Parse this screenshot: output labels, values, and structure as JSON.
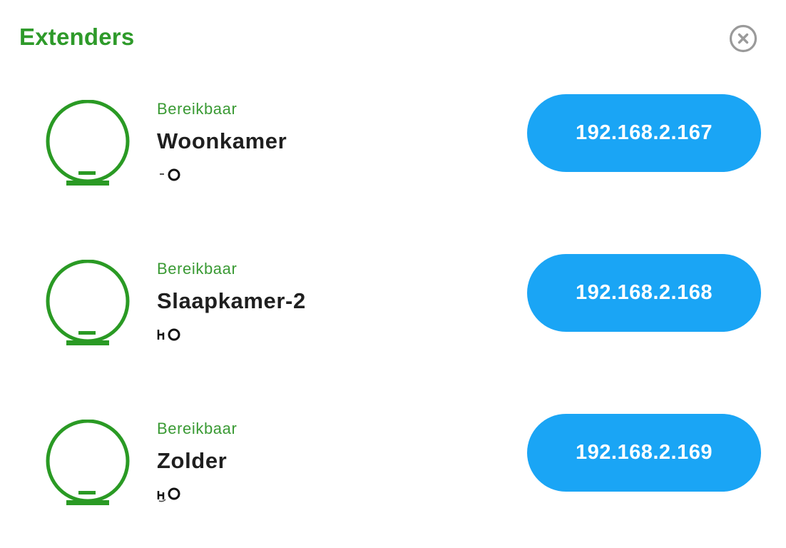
{
  "header": {
    "title": "Extenders",
    "close_icon": "close-circle-icon",
    "accent_color": "#2e9a2a"
  },
  "extenders": [
    {
      "status": "Bereikbaar",
      "name": "Woonkamer",
      "ip": "192.168.2.167",
      "device_icon": "extender-device-icon",
      "signal_icon": "connection-status-icon"
    },
    {
      "status": "Bereikbaar",
      "name": "Slaapkamer-2",
      "ip": "192.168.2.168",
      "device_icon": "extender-device-icon",
      "signal_icon": "connection-status-icon"
    },
    {
      "status": "Bereikbaar",
      "name": "Zolder",
      "ip": "192.168.2.169",
      "device_icon": "extender-device-icon",
      "signal_icon": "connection-status-icon"
    }
  ],
  "colors": {
    "status_text": "#3a9a34",
    "device_icon": "#2a9a24",
    "ip_button_bg": "#1aa5f5",
    "ip_button_text": "#ffffff",
    "name_text": "#1f1f1f",
    "close_icon": "#9a9a9a"
  }
}
